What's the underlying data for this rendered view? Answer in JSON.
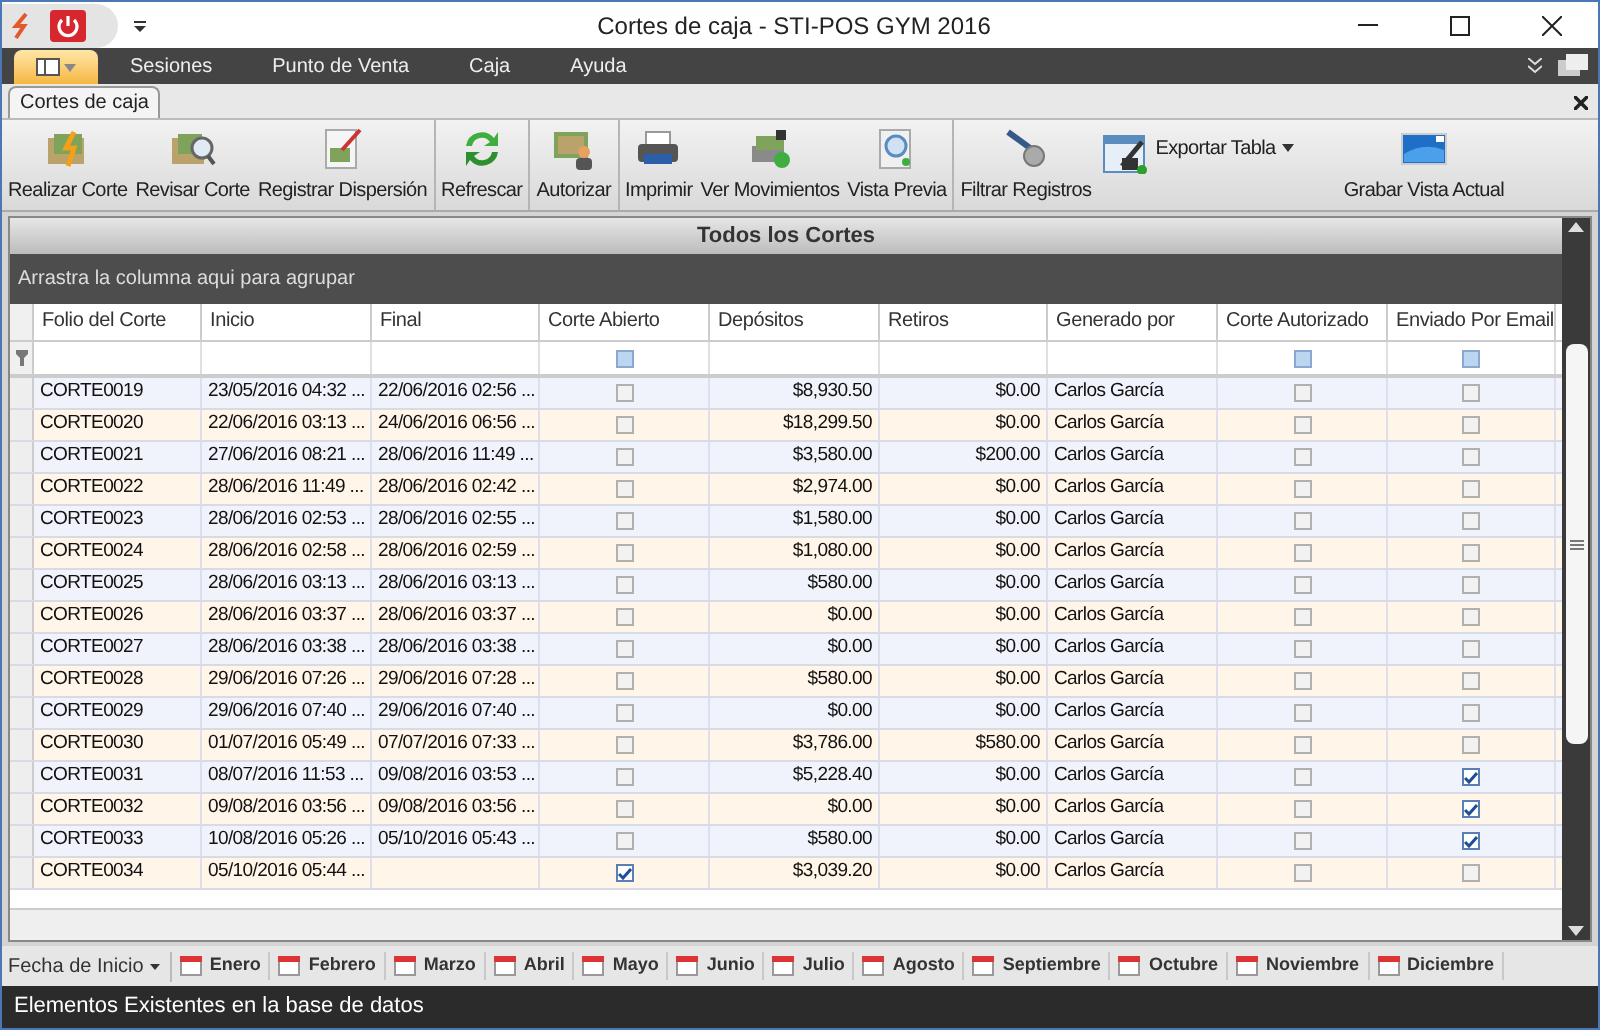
{
  "window": {
    "title": "Cortes de caja - STI-POS GYM 2016"
  },
  "menu": [
    {
      "label": "Sesiones"
    },
    {
      "label": "Punto de Venta"
    },
    {
      "label": "Caja"
    },
    {
      "label": "Ayuda"
    }
  ],
  "document_tabs": [
    {
      "label": "Cortes de caja",
      "selected": true
    }
  ],
  "ribbon_groups": [
    [
      {
        "label": "Realizar Corte",
        "kind": "large"
      },
      {
        "label": "Revisar Corte",
        "kind": "large"
      },
      {
        "label": "Registrar Dispersión",
        "kind": "large"
      }
    ],
    [
      {
        "label": "Refrescar",
        "kind": "large"
      }
    ],
    [
      {
        "label": "Autorizar",
        "kind": "large"
      }
    ],
    [
      {
        "label": "Imprimir",
        "kind": "large"
      },
      {
        "label": "Ver Movimientos",
        "kind": "large"
      },
      {
        "label": "Vista Previa",
        "kind": "large"
      }
    ],
    [
      {
        "label": "Filtrar Registros",
        "kind": "large"
      },
      {
        "label": "Exportar Tabla",
        "kind": "split"
      },
      {
        "label": "Grabar Vista Actual",
        "kind": "large"
      }
    ]
  ],
  "grid": {
    "title": "Todos los Cortes",
    "group_panel": "Arrastra la columna aqui para agrupar",
    "columns": [
      {
        "label": "Folio del Corte"
      },
      {
        "label": "Inicio"
      },
      {
        "label": "Final"
      },
      {
        "label": "Corte Abierto",
        "filter_indeterminate": true
      },
      {
        "label": "Depósitos"
      },
      {
        "label": "Retiros"
      },
      {
        "label": "Generado por"
      },
      {
        "label": "Corte Autorizado",
        "filter_indeterminate": true
      },
      {
        "label": "Enviado Por Email",
        "filter_indeterminate": true
      }
    ],
    "rows": [
      {
        "folio": "CORTE0019",
        "inicio": "23/05/2016 04:32 ...",
        "final": "22/06/2016 02:56 ...",
        "abierto": false,
        "depositos": "$8,930.50",
        "retiros": "$0.00",
        "generado": "Carlos García",
        "autorizado": false,
        "email": false
      },
      {
        "folio": "CORTE0020",
        "inicio": "22/06/2016 03:13 ...",
        "final": "24/06/2016 06:56 ...",
        "abierto": false,
        "depositos": "$18,299.50",
        "retiros": "$0.00",
        "generado": "Carlos García",
        "autorizado": false,
        "email": false
      },
      {
        "folio": "CORTE0021",
        "inicio": "27/06/2016 08:21 ...",
        "final": "28/06/2016 11:49 ...",
        "abierto": false,
        "depositos": "$3,580.00",
        "retiros": "$200.00",
        "generado": "Carlos García",
        "autorizado": false,
        "email": false
      },
      {
        "folio": "CORTE0022",
        "inicio": "28/06/2016 11:49 ...",
        "final": "28/06/2016 02:42 ...",
        "abierto": false,
        "depositos": "$2,974.00",
        "retiros": "$0.00",
        "generado": "Carlos García",
        "autorizado": false,
        "email": false
      },
      {
        "folio": "CORTE0023",
        "inicio": "28/06/2016 02:53 ...",
        "final": "28/06/2016 02:55 ...",
        "abierto": false,
        "depositos": "$1,580.00",
        "retiros": "$0.00",
        "generado": "Carlos García",
        "autorizado": false,
        "email": false
      },
      {
        "folio": "CORTE0024",
        "inicio": "28/06/2016 02:58 ...",
        "final": "28/06/2016 02:59 ...",
        "abierto": false,
        "depositos": "$1,080.00",
        "retiros": "$0.00",
        "generado": "Carlos García",
        "autorizado": false,
        "email": false
      },
      {
        "folio": "CORTE0025",
        "inicio": "28/06/2016 03:13 ...",
        "final": "28/06/2016 03:13 ...",
        "abierto": false,
        "depositos": "$580.00",
        "retiros": "$0.00",
        "generado": "Carlos García",
        "autorizado": false,
        "email": false
      },
      {
        "folio": "CORTE0026",
        "inicio": "28/06/2016 03:37 ...",
        "final": "28/06/2016 03:37 ...",
        "abierto": false,
        "depositos": "$0.00",
        "retiros": "$0.00",
        "generado": "Carlos García",
        "autorizado": false,
        "email": false
      },
      {
        "folio": "CORTE0027",
        "inicio": "28/06/2016 03:38 ...",
        "final": "28/06/2016 03:38 ...",
        "abierto": false,
        "depositos": "$0.00",
        "retiros": "$0.00",
        "generado": "Carlos García",
        "autorizado": false,
        "email": false
      },
      {
        "folio": "CORTE0028",
        "inicio": "29/06/2016 07:26 ...",
        "final": "29/06/2016 07:28 ...",
        "abierto": false,
        "depositos": "$580.00",
        "retiros": "$0.00",
        "generado": "Carlos García",
        "autorizado": false,
        "email": false
      },
      {
        "folio": "CORTE0029",
        "inicio": "29/06/2016 07:40 ...",
        "final": "29/06/2016 07:40 ...",
        "abierto": false,
        "depositos": "$0.00",
        "retiros": "$0.00",
        "generado": "Carlos García",
        "autorizado": false,
        "email": false
      },
      {
        "folio": "CORTE0030",
        "inicio": "01/07/2016 05:49 ...",
        "final": "07/07/2016 07:33 ...",
        "abierto": false,
        "depositos": "$3,786.00",
        "retiros": "$580.00",
        "generado": "Carlos García",
        "autorizado": false,
        "email": false
      },
      {
        "folio": "CORTE0031",
        "inicio": "08/07/2016 11:53 ...",
        "final": "09/08/2016 03:53 ...",
        "abierto": false,
        "depositos": "$5,228.40",
        "retiros": "$0.00",
        "generado": "Carlos García",
        "autorizado": false,
        "email": true
      },
      {
        "folio": "CORTE0032",
        "inicio": "09/08/2016 03:56 ...",
        "final": "09/08/2016 03:56 ...",
        "abierto": false,
        "depositos": "$0.00",
        "retiros": "$0.00",
        "generado": "Carlos García",
        "autorizado": false,
        "email": true
      },
      {
        "folio": "CORTE0033",
        "inicio": "10/08/2016 05:26 ...",
        "final": "05/10/2016 05:43 ...",
        "abierto": false,
        "depositos": "$580.00",
        "retiros": "$0.00",
        "generado": "Carlos García",
        "autorizado": false,
        "email": true
      },
      {
        "folio": "CORTE0034",
        "inicio": "05/10/2016 05:44 ...",
        "abierto": true,
        "depositos": "$3,039.20",
        "retiros": "$0.00",
        "generado": "Carlos García",
        "autorizado": false,
        "email": false
      }
    ]
  },
  "date_filter": {
    "label": "Fecha de Inicio",
    "months": [
      "Enero",
      "Febrero",
      "Marzo",
      "Abril",
      "Mayo",
      "Junio",
      "Julio",
      "Agosto",
      "Septiembre",
      "Octubre",
      "Noviembre",
      "Diciembre"
    ]
  },
  "status_bar": "Elementos Existentes en la base de datos"
}
